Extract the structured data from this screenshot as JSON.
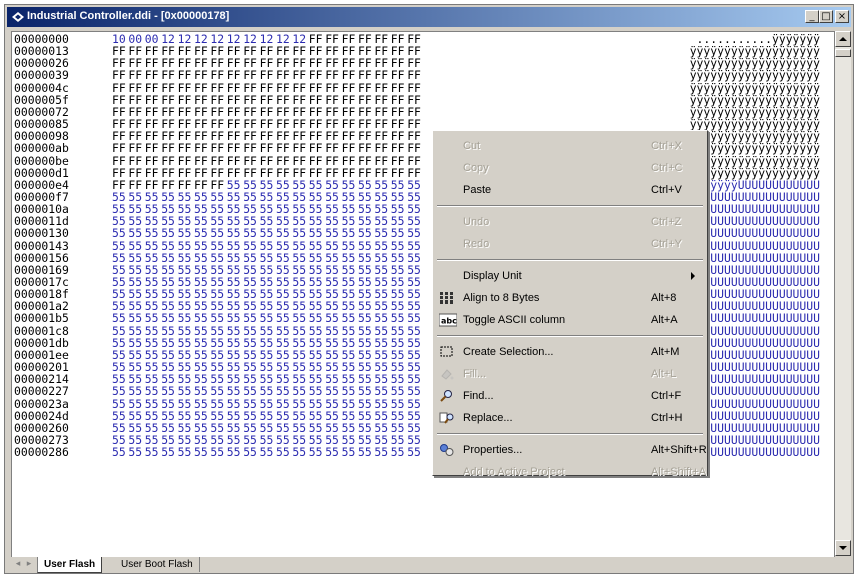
{
  "window": {
    "title": "Industrial Controller.ddi - [0x00000178]",
    "minimize": "_",
    "restore": "□",
    "close": "×"
  },
  "hex": {
    "rows": [
      {
        "addr": "00000000",
        "bytes": [
          "10",
          "00",
          "00",
          "12",
          "12",
          "12",
          "12",
          "12",
          "12",
          "12",
          "12",
          "12",
          "FF",
          "FF",
          "FF",
          "FF",
          "FF",
          "FF",
          "FF"
        ],
        "ascii": "...........ÿÿÿÿÿÿÿ"
      },
      {
        "addr": "00000013",
        "bytes": [
          "FF",
          "FF",
          "FF",
          "FF",
          "FF",
          "FF",
          "FF",
          "FF",
          "FF",
          "FF",
          "FF",
          "FF",
          "FF",
          "FF",
          "FF",
          "FF",
          "FF",
          "FF",
          "FF"
        ],
        "ascii": "ÿÿÿÿÿÿÿÿÿÿÿÿÿÿÿÿÿÿÿ"
      },
      {
        "addr": "00000026",
        "bytes": [
          "FF",
          "FF",
          "FF",
          "FF",
          "FF",
          "FF",
          "FF",
          "FF",
          "FF",
          "FF",
          "FF",
          "FF",
          "FF",
          "FF",
          "FF",
          "FF",
          "FF",
          "FF",
          "FF"
        ],
        "ascii": "ÿÿÿÿÿÿÿÿÿÿÿÿÿÿÿÿÿÿÿ"
      },
      {
        "addr": "00000039",
        "bytes": [
          "FF",
          "FF",
          "FF",
          "FF",
          "FF",
          "FF",
          "FF",
          "FF",
          "FF",
          "FF",
          "FF",
          "FF",
          "FF",
          "FF",
          "FF",
          "FF",
          "FF",
          "FF",
          "FF"
        ],
        "ascii": "ÿÿÿÿÿÿÿÿÿÿÿÿÿÿÿÿÿÿÿ"
      },
      {
        "addr": "0000004c",
        "bytes": [
          "FF",
          "FF",
          "FF",
          "FF",
          "FF",
          "FF",
          "FF",
          "FF",
          "FF",
          "FF",
          "FF",
          "FF",
          "FF",
          "FF",
          "FF",
          "FF",
          "FF",
          "FF",
          "FF"
        ],
        "ascii": "ÿÿÿÿÿÿÿÿÿÿÿÿÿÿÿÿÿÿÿ"
      },
      {
        "addr": "0000005f",
        "bytes": [
          "FF",
          "FF",
          "FF",
          "FF",
          "FF",
          "FF",
          "FF",
          "FF",
          "FF",
          "FF",
          "FF",
          "FF",
          "FF",
          "FF",
          "FF",
          "FF",
          "FF",
          "FF",
          "FF"
        ],
        "ascii": "ÿÿÿÿÿÿÿÿÿÿÿÿÿÿÿÿÿÿÿ"
      },
      {
        "addr": "00000072",
        "bytes": [
          "FF",
          "FF",
          "FF",
          "FF",
          "FF",
          "FF",
          "FF",
          "FF",
          "FF",
          "FF",
          "FF",
          "FF",
          "FF",
          "FF",
          "FF",
          "FF",
          "FF",
          "FF",
          "FF"
        ],
        "ascii": "ÿÿÿÿÿÿÿÿÿÿÿÿÿÿÿÿÿÿÿ"
      },
      {
        "addr": "00000085",
        "bytes": [
          "FF",
          "FF",
          "FF",
          "FF",
          "FF",
          "FF",
          "FF",
          "FF",
          "FF",
          "FF",
          "FF",
          "FF",
          "FF",
          "FF",
          "FF",
          "FF",
          "FF",
          "FF",
          "FF"
        ],
        "ascii": "ÿÿÿÿÿÿÿÿÿÿÿÿÿÿÿÿÿÿÿ"
      },
      {
        "addr": "00000098",
        "bytes": [
          "FF",
          "FF",
          "FF",
          "FF",
          "FF",
          "FF",
          "FF",
          "FF",
          "FF",
          "FF",
          "FF",
          "FF",
          "FF",
          "FF",
          "FF",
          "FF",
          "FF",
          "FF",
          "FF"
        ],
        "ascii": "ÿÿÿÿÿÿÿÿÿÿÿÿÿÿÿÿÿÿÿ"
      },
      {
        "addr": "000000ab",
        "bytes": [
          "FF",
          "FF",
          "FF",
          "FF",
          "FF",
          "FF",
          "FF",
          "FF",
          "FF",
          "FF",
          "FF",
          "FF",
          "FF",
          "FF",
          "FF",
          "FF",
          "FF",
          "FF",
          "FF"
        ],
        "ascii": "ÿÿÿÿÿÿÿÿÿÿÿÿÿÿÿÿÿÿÿ"
      },
      {
        "addr": "000000be",
        "bytes": [
          "FF",
          "FF",
          "FF",
          "FF",
          "FF",
          "FF",
          "FF",
          "FF",
          "FF",
          "FF",
          "FF",
          "FF",
          "FF",
          "FF",
          "FF",
          "FF",
          "FF",
          "FF",
          "FF"
        ],
        "ascii": "ÿÿÿÿÿÿÿÿÿÿÿÿÿÿÿÿÿÿÿ"
      },
      {
        "addr": "000000d1",
        "bytes": [
          "FF",
          "FF",
          "FF",
          "FF",
          "FF",
          "FF",
          "FF",
          "FF",
          "FF",
          "FF",
          "FF",
          "FF",
          "FF",
          "FF",
          "FF",
          "FF",
          "FF",
          "FF",
          "FF"
        ],
        "ascii": "ÿÿÿÿÿÿÿÿÿÿÿÿÿÿÿÿÿÿÿ"
      },
      {
        "addr": "000000e4",
        "bytes": [
          "FF",
          "FF",
          "FF",
          "FF",
          "FF",
          "FF",
          "FF",
          "55",
          "55",
          "55",
          "55",
          "55",
          "55",
          "55",
          "55",
          "55",
          "55",
          "55",
          "55"
        ],
        "ascii": "ÿÿÿÿÿÿÿUUUUUUUUUUUU"
      },
      {
        "addr": "000000f7",
        "bytes": [
          "55",
          "55",
          "55",
          "55",
          "55",
          "55",
          "55",
          "55",
          "55",
          "55",
          "55",
          "55",
          "55",
          "55",
          "55",
          "55",
          "55",
          "55",
          "55"
        ],
        "ascii": "UUUUUUUUUUUUUUUUUUU"
      },
      {
        "addr": "0000010a",
        "bytes": [
          "55",
          "55",
          "55",
          "55",
          "55",
          "55",
          "55",
          "55",
          "55",
          "55",
          "55",
          "55",
          "55",
          "55",
          "55",
          "55",
          "55",
          "55",
          "55"
        ],
        "ascii": "UUUUUUUUUUUUUUUUUUU"
      },
      {
        "addr": "0000011d",
        "bytes": [
          "55",
          "55",
          "55",
          "55",
          "55",
          "55",
          "55",
          "55",
          "55",
          "55",
          "55",
          "55",
          "55",
          "55",
          "55",
          "55",
          "55",
          "55",
          "55"
        ],
        "ascii": "UUUUUUUUUUUUUUUUUUU"
      },
      {
        "addr": "00000130",
        "bytes": [
          "55",
          "55",
          "55",
          "55",
          "55",
          "55",
          "55",
          "55",
          "55",
          "55",
          "55",
          "55",
          "55",
          "55",
          "55",
          "55",
          "55",
          "55",
          "55"
        ],
        "ascii": "UUUUUUUUUUUUUUUUUUU"
      },
      {
        "addr": "00000143",
        "bytes": [
          "55",
          "55",
          "55",
          "55",
          "55",
          "55",
          "55",
          "55",
          "55",
          "55",
          "55",
          "55",
          "55",
          "55",
          "55",
          "55",
          "55",
          "55",
          "55"
        ],
        "ascii": "UUUUUUUUUUUUUUUUUUU"
      },
      {
        "addr": "00000156",
        "bytes": [
          "55",
          "55",
          "55",
          "55",
          "55",
          "55",
          "55",
          "55",
          "55",
          "55",
          "55",
          "55",
          "55",
          "55",
          "55",
          "55",
          "55",
          "55",
          "55"
        ],
        "ascii": "UUUUUUUUUUUUUUUUUUU"
      },
      {
        "addr": "00000169",
        "bytes": [
          "55",
          "55",
          "55",
          "55",
          "55",
          "55",
          "55",
          "55",
          "55",
          "55",
          "55",
          "55",
          "55",
          "55",
          "55",
          "55",
          "55",
          "55",
          "55"
        ],
        "ascii": "UUUUUUUUUUUUUUUUUUU"
      },
      {
        "addr": "0000017c",
        "bytes": [
          "55",
          "55",
          "55",
          "55",
          "55",
          "55",
          "55",
          "55",
          "55",
          "55",
          "55",
          "55",
          "55",
          "55",
          "55",
          "55",
          "55",
          "55",
          "55"
        ],
        "ascii": "UUUUUUUUUUUUUUUUUUU"
      },
      {
        "addr": "0000018f",
        "bytes": [
          "55",
          "55",
          "55",
          "55",
          "55",
          "55",
          "55",
          "55",
          "55",
          "55",
          "55",
          "55",
          "55",
          "55",
          "55",
          "55",
          "55",
          "55",
          "55"
        ],
        "ascii": "UUUUUUUUUUUUUUUUUUU"
      },
      {
        "addr": "000001a2",
        "bytes": [
          "55",
          "55",
          "55",
          "55",
          "55",
          "55",
          "55",
          "55",
          "55",
          "55",
          "55",
          "55",
          "55",
          "55",
          "55",
          "55",
          "55",
          "55",
          "55"
        ],
        "ascii": "UUUUUUUUUUUUUUUUUUU"
      },
      {
        "addr": "000001b5",
        "bytes": [
          "55",
          "55",
          "55",
          "55",
          "55",
          "55",
          "55",
          "55",
          "55",
          "55",
          "55",
          "55",
          "55",
          "55",
          "55",
          "55",
          "55",
          "55",
          "55"
        ],
        "ascii": "UUUUUUUUUUUUUUUUUUU"
      },
      {
        "addr": "000001c8",
        "bytes": [
          "55",
          "55",
          "55",
          "55",
          "55",
          "55",
          "55",
          "55",
          "55",
          "55",
          "55",
          "55",
          "55",
          "55",
          "55",
          "55",
          "55",
          "55",
          "55"
        ],
        "ascii": "UUUUUUUUUUUUUUUUUUU"
      },
      {
        "addr": "000001db",
        "bytes": [
          "55",
          "55",
          "55",
          "55",
          "55",
          "55",
          "55",
          "55",
          "55",
          "55",
          "55",
          "55",
          "55",
          "55",
          "55",
          "55",
          "55",
          "55",
          "55"
        ],
        "ascii": "UUUUUUUUUUUUUUUUUUU"
      },
      {
        "addr": "000001ee",
        "bytes": [
          "55",
          "55",
          "55",
          "55",
          "55",
          "55",
          "55",
          "55",
          "55",
          "55",
          "55",
          "55",
          "55",
          "55",
          "55",
          "55",
          "55",
          "55",
          "55"
        ],
        "ascii": "UUUUUUUUUUUUUUUUUUU"
      },
      {
        "addr": "00000201",
        "bytes": [
          "55",
          "55",
          "55",
          "55",
          "55",
          "55",
          "55",
          "55",
          "55",
          "55",
          "55",
          "55",
          "55",
          "55",
          "55",
          "55",
          "55",
          "55",
          "55"
        ],
        "ascii": "UUUUUUUUUUUUUUUUUUU"
      },
      {
        "addr": "00000214",
        "bytes": [
          "55",
          "55",
          "55",
          "55",
          "55",
          "55",
          "55",
          "55",
          "55",
          "55",
          "55",
          "55",
          "55",
          "55",
          "55",
          "55",
          "55",
          "55",
          "55"
        ],
        "ascii": "UUUUUUUUUUUUUUUUUUU"
      },
      {
        "addr": "00000227",
        "bytes": [
          "55",
          "55",
          "55",
          "55",
          "55",
          "55",
          "55",
          "55",
          "55",
          "55",
          "55",
          "55",
          "55",
          "55",
          "55",
          "55",
          "55",
          "55",
          "55"
        ],
        "ascii": "UUUUUUUUUUUUUUUUUUU"
      },
      {
        "addr": "0000023a",
        "bytes": [
          "55",
          "55",
          "55",
          "55",
          "55",
          "55",
          "55",
          "55",
          "55",
          "55",
          "55",
          "55",
          "55",
          "55",
          "55",
          "55",
          "55",
          "55",
          "55"
        ],
        "ascii": "UUUUUUUUUUUUUUUUUUU"
      },
      {
        "addr": "0000024d",
        "bytes": [
          "55",
          "55",
          "55",
          "55",
          "55",
          "55",
          "55",
          "55",
          "55",
          "55",
          "55",
          "55",
          "55",
          "55",
          "55",
          "55",
          "55",
          "55",
          "55"
        ],
        "ascii": "UUUUUUUUUUUUUUUUUUU"
      },
      {
        "addr": "00000260",
        "bytes": [
          "55",
          "55",
          "55",
          "55",
          "55",
          "55",
          "55",
          "55",
          "55",
          "55",
          "55",
          "55",
          "55",
          "55",
          "55",
          "55",
          "55",
          "55",
          "55"
        ],
        "ascii": "UUUUUUUUUUUUUUUUUUU"
      },
      {
        "addr": "00000273",
        "bytes": [
          "55",
          "55",
          "55",
          "55",
          "55",
          "55",
          "55",
          "55",
          "55",
          "55",
          "55",
          "55",
          "55",
          "55",
          "55",
          "55",
          "55",
          "55",
          "55"
        ],
        "ascii": "UUUUUUUUUUUUUUUUUUU"
      },
      {
        "addr": "00000286",
        "bytes": [
          "55",
          "55",
          "55",
          "55",
          "55",
          "55",
          "55",
          "55",
          "55",
          "55",
          "55",
          "55",
          "55",
          "55",
          "55",
          "55",
          "55",
          "55",
          "55"
        ],
        "ascii": "UUUUUUUUUUUUUUUUUUU"
      }
    ]
  },
  "tabs": [
    {
      "label": "User Flash",
      "active": true
    },
    {
      "label": "User Boot Flash",
      "active": false
    }
  ],
  "tab_nav": {
    "prev": "◂",
    "next": "▸"
  },
  "context_menu": {
    "items": [
      {
        "label": "Cut",
        "shortcut": "Ctrl+X",
        "disabled": true,
        "icon": ""
      },
      {
        "label": "Copy",
        "shortcut": "Ctrl+C",
        "disabled": true,
        "icon": ""
      },
      {
        "label": "Paste",
        "shortcut": "Ctrl+V",
        "disabled": false,
        "icon": ""
      },
      {
        "sep": true
      },
      {
        "label": "Undo",
        "shortcut": "Ctrl+Z",
        "disabled": true,
        "icon": ""
      },
      {
        "label": "Redo",
        "shortcut": "Ctrl+Y",
        "disabled": true,
        "icon": ""
      },
      {
        "sep": true
      },
      {
        "label": "Display Unit",
        "shortcut": "",
        "disabled": false,
        "icon": "",
        "submenu": true
      },
      {
        "label": "Align to 8 Bytes",
        "shortcut": "Alt+8",
        "disabled": false,
        "icon": "align-bytes-icon"
      },
      {
        "label": "Toggle ASCII column",
        "shortcut": "Alt+A",
        "disabled": false,
        "icon": "abc-icon"
      },
      {
        "sep": true
      },
      {
        "label": "Create Selection...",
        "shortcut": "Alt+M",
        "disabled": false,
        "icon": "selection-icon"
      },
      {
        "label": "Fill...",
        "shortcut": "Alt+L",
        "disabled": true,
        "icon": "fill-icon"
      },
      {
        "label": "Find...",
        "shortcut": "Ctrl+F",
        "disabled": false,
        "icon": "find-icon"
      },
      {
        "label": "Replace...",
        "shortcut": "Ctrl+H",
        "disabled": false,
        "icon": "replace-icon"
      },
      {
        "sep": true
      },
      {
        "label": "Properties...",
        "shortcut": "Alt+Shift+R",
        "disabled": false,
        "icon": "properties-icon"
      },
      {
        "label": "Add to Active Project",
        "shortcut": "Alt+Shift+A",
        "disabled": true,
        "icon": ""
      }
    ]
  },
  "colors": {
    "title_start": "#0a246a",
    "title_end": "#a6caf0",
    "byte_blue": "#2b2bb0",
    "face": "#d4d0c8"
  }
}
